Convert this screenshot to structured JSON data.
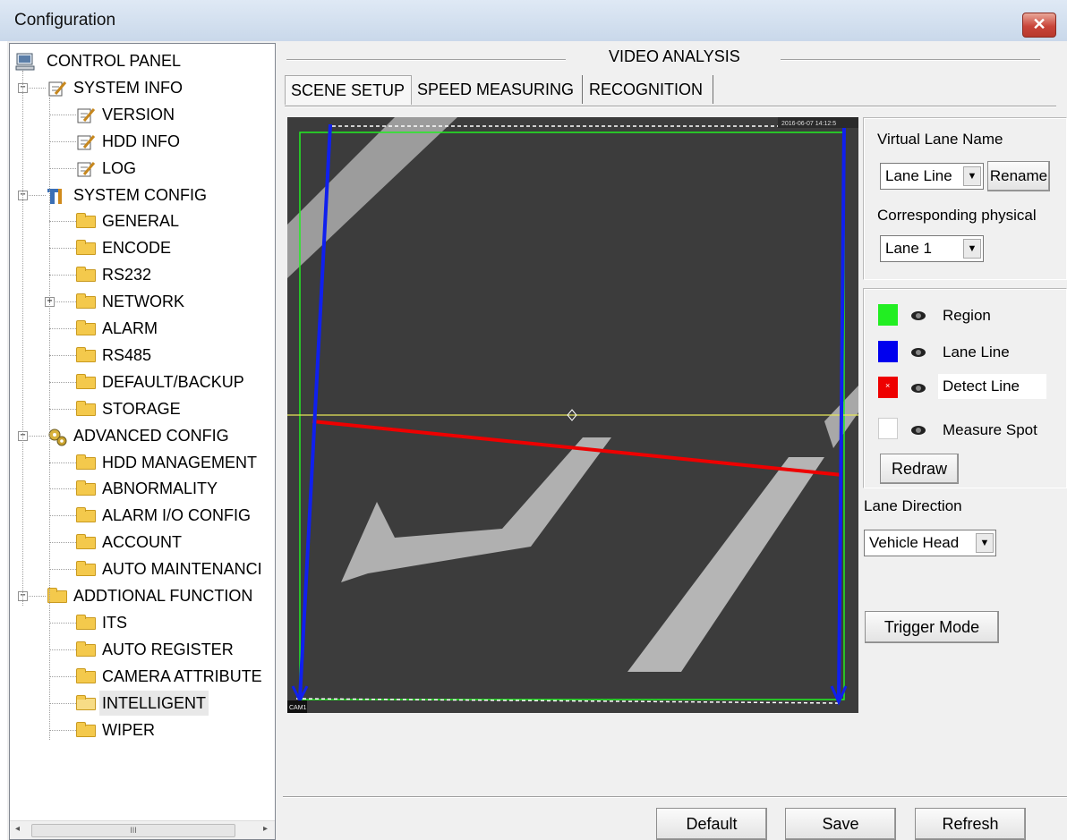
{
  "window": {
    "title": "Configuration",
    "close_label": "✕"
  },
  "tree": {
    "nodes": [
      {
        "label": "CONTROL PANEL",
        "icon": "monitor-icon",
        "level": 0
      },
      {
        "label": "SYSTEM INFO",
        "icon": "notepad-icon",
        "level": 1,
        "expander": "−"
      },
      {
        "label": "VERSION",
        "icon": "notepad-icon",
        "level": 2
      },
      {
        "label": "HDD INFO",
        "icon": "notepad-icon",
        "level": 2
      },
      {
        "label": "LOG",
        "icon": "notepad-icon",
        "level": 2
      },
      {
        "label": "SYSTEM CONFIG",
        "icon": "tools-icon",
        "level": 1,
        "expander": "−"
      },
      {
        "label": "GENERAL",
        "icon": "folder-icon",
        "level": 2
      },
      {
        "label": "ENCODE",
        "icon": "folder-icon",
        "level": 2
      },
      {
        "label": "RS232",
        "icon": "folder-icon",
        "level": 2
      },
      {
        "label": "NETWORK",
        "icon": "folder-icon",
        "level": 2,
        "expander": "+"
      },
      {
        "label": "ALARM",
        "icon": "folder-icon",
        "level": 2
      },
      {
        "label": "RS485",
        "icon": "folder-icon",
        "level": 2
      },
      {
        "label": "DEFAULT/BACKUP",
        "icon": "folder-icon",
        "level": 2
      },
      {
        "label": "STORAGE",
        "icon": "folder-icon",
        "level": 2
      },
      {
        "label": "ADVANCED CONFIG",
        "icon": "gears-icon",
        "level": 1,
        "expander": "−"
      },
      {
        "label": "HDD MANAGEMENT",
        "icon": "folder-icon",
        "level": 2
      },
      {
        "label": "ABNORMALITY",
        "icon": "folder-icon",
        "level": 2
      },
      {
        "label": "ALARM I/O CONFIG",
        "icon": "folder-icon",
        "level": 2
      },
      {
        "label": "ACCOUNT",
        "icon": "folder-icon",
        "level": 2
      },
      {
        "label": "AUTO MAINTENANCI",
        "icon": "folder-icon",
        "level": 2
      },
      {
        "label": "ADDTIONAL FUNCTION",
        "icon": "folder-icon",
        "level": 1,
        "expander": "−"
      },
      {
        "label": "ITS",
        "icon": "folder-icon",
        "level": 2
      },
      {
        "label": "AUTO REGISTER",
        "icon": "folder-icon",
        "level": 2
      },
      {
        "label": "CAMERA ATTRIBUTE",
        "icon": "folder-icon",
        "level": 2
      },
      {
        "label": "INTELLIGENT",
        "icon": "open-folder-icon",
        "level": 2,
        "selected": true
      },
      {
        "label": "WIPER",
        "icon": "folder-icon",
        "level": 2
      }
    ],
    "scroll_thumb": "III"
  },
  "header": {
    "title": "VIDEO ANALYSIS"
  },
  "tabs": [
    {
      "label": "SCENE SETUP",
      "active": true
    },
    {
      "label": "SPEED MEASURING",
      "active": false
    },
    {
      "label": "RECOGNITION",
      "active": false
    }
  ],
  "video": {
    "timestamp": "2016-06-07 14:12:5",
    "channel": "CAM1"
  },
  "lane": {
    "virtual_lane_name_label": "Virtual Lane Name",
    "virtual_lane_value": "Lane Line",
    "rename_label": "Rename",
    "physical_label": "Corresponding physical",
    "physical_value": "Lane 1"
  },
  "legend": [
    {
      "label": "Region",
      "color": "#22ee22"
    },
    {
      "label": "Lane Line",
      "color": "#0000ee"
    },
    {
      "label": "Detect Line",
      "color": "#ee0000"
    },
    {
      "label": "Measure Spot",
      "color": "#ffffff"
    }
  ],
  "redraw_label": "Redraw",
  "direction": {
    "label": "Lane Direction",
    "value": "Vehicle Head"
  },
  "trigger_label": "Trigger Mode",
  "footer": {
    "default_label": "Default",
    "save_label": "Save",
    "refresh_label": "Refresh"
  }
}
